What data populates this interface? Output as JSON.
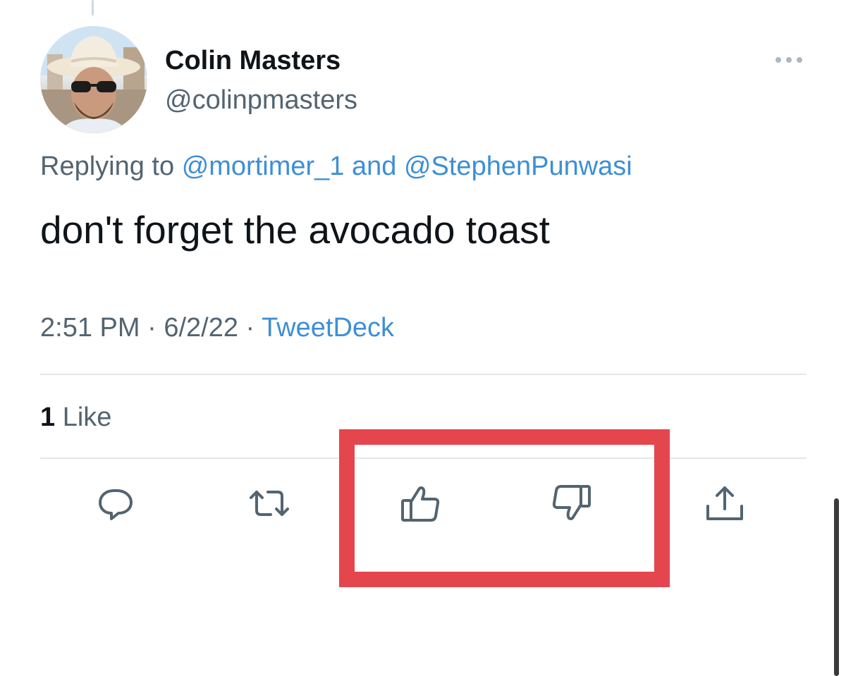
{
  "tweet": {
    "author": {
      "display_name": "Colin Masters",
      "handle": "@colinpmasters",
      "avatar_icon": "profile-photo"
    },
    "reply_context": {
      "prefix": "Replying to",
      "user1": "@mortimer_1",
      "joiner": "and",
      "user2": "@StephenPunwasi"
    },
    "text": "don't forget the avocado toast",
    "meta": {
      "time": "2:51 PM",
      "separator": "·",
      "date": "6/2/22",
      "source": "TweetDeck"
    },
    "stats": {
      "likes_count": "1",
      "likes_label": "Like"
    },
    "actions": [
      {
        "name": "reply",
        "icon": "speech-bubble-icon"
      },
      {
        "name": "retweet",
        "icon": "retweet-icon"
      },
      {
        "name": "upvote",
        "icon": "thumbs-up-icon"
      },
      {
        "name": "downvote",
        "icon": "thumbs-down-icon"
      },
      {
        "name": "share",
        "icon": "share-icon"
      }
    ],
    "more_menu_icon": "ellipsis-icon"
  },
  "colors": {
    "link": "#3d8fd6",
    "secondary_text": "#536471",
    "primary_text": "#0f1419",
    "icon": "#536471",
    "highlight": "#e5454d",
    "divider": "#e3e7ea"
  }
}
